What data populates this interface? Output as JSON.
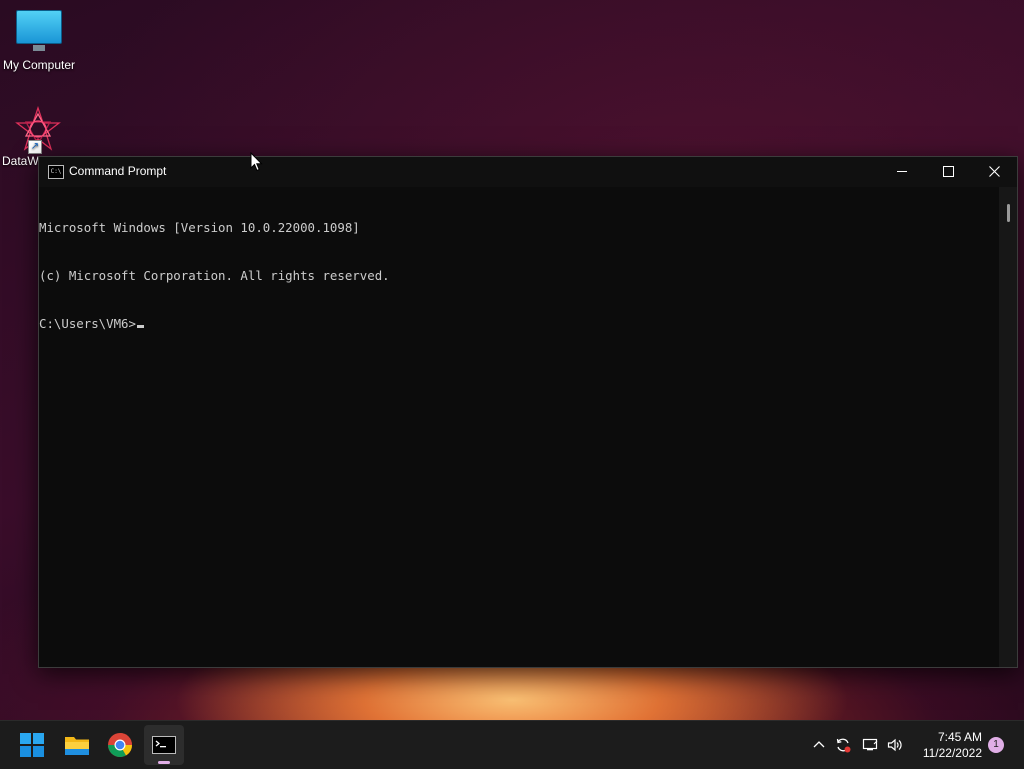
{
  "desktop": {
    "icons": [
      {
        "label": "My Computer"
      },
      {
        "label": "DataW"
      }
    ]
  },
  "cmd_window": {
    "title": "Command Prompt",
    "lines": [
      "Microsoft Windows [Version 10.0.22000.1098]",
      "(c) Microsoft Corporation. All rights reserved.",
      "C:\\Users\\VM6>"
    ],
    "buttons": {
      "minimize": "minimize-icon",
      "maximize": "maximize-icon",
      "close": "close-icon"
    },
    "colors": {
      "background": "#0c0c0c",
      "text": "#cccccc"
    }
  },
  "taskbar": {
    "apps": [
      {
        "name": "start-icon"
      },
      {
        "name": "file-explorer-icon"
      },
      {
        "name": "chrome-icon"
      },
      {
        "name": "command-prompt-icon",
        "running": true
      }
    ],
    "tray": {
      "time": "7:45 AM",
      "date": "11/22/2022",
      "notification_count": "1"
    }
  }
}
